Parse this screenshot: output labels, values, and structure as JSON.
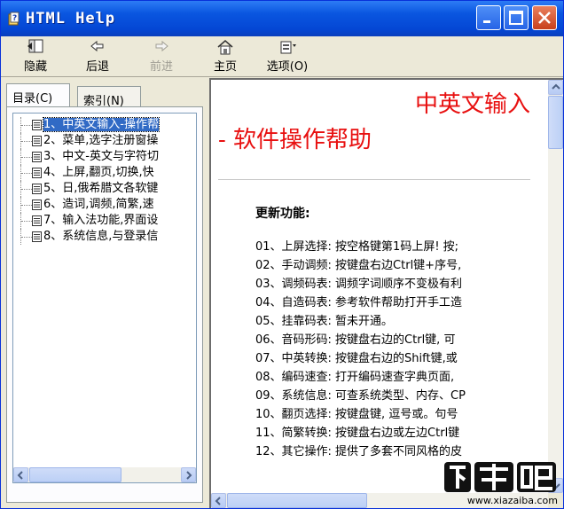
{
  "window": {
    "title": "HTML Help"
  },
  "toolbar": {
    "hide": "隐藏",
    "back": "后退",
    "forward": "前进",
    "home": "主页",
    "options": "选项(O)"
  },
  "tabs": {
    "contents": "目录(C)",
    "index": "索引(N)"
  },
  "tree": {
    "items": [
      "1、中英文输入-操作帮",
      "2、菜单,选字注册窗操",
      "3、中文-英文与字符切",
      "4、上屏,翻页,切换,快",
      "5、日,俄希腊文各软键",
      "6、造词,调频,简繁,速",
      "7、输入法功能,界面设",
      "8、系统信息,与登录信"
    ]
  },
  "content": {
    "heading_line1": "中英文输入",
    "heading_line2": "- 软件操作帮助",
    "subheading": "更新功能:",
    "features": [
      "01、上屏选择: 按空格键第1码上屏! 按;",
      "02、手动调频: 按键盘右边Ctrl键+序号,",
      "03、调频码表: 调频字词顺序不变极有利",
      "04、自造码表: 参考软件帮助打开手工造",
      "05、挂靠码表: 暂未开通。",
      "06、音码形码: 按键盘右边的Ctrl键, 可",
      "07、中英转换: 按键盘右边的Shift键,或",
      "08、编码速查: 打开编码速查字典页面,",
      "09、系统信息: 可查系统类型、内存、CP",
      "10、翻页选择: 按键盘键, 逗号或。句号",
      "11、简繁转换: 按键盘右边或左边Ctrl键",
      "12、其它操作: 提供了多套不同风格的皮"
    ]
  },
  "watermark": {
    "logo": "下载吧",
    "url": "www.xiazaiba.com"
  },
  "colors": {
    "heading": "#e81010",
    "titlebar": "#0a56e0",
    "selection": "#316ac5"
  }
}
